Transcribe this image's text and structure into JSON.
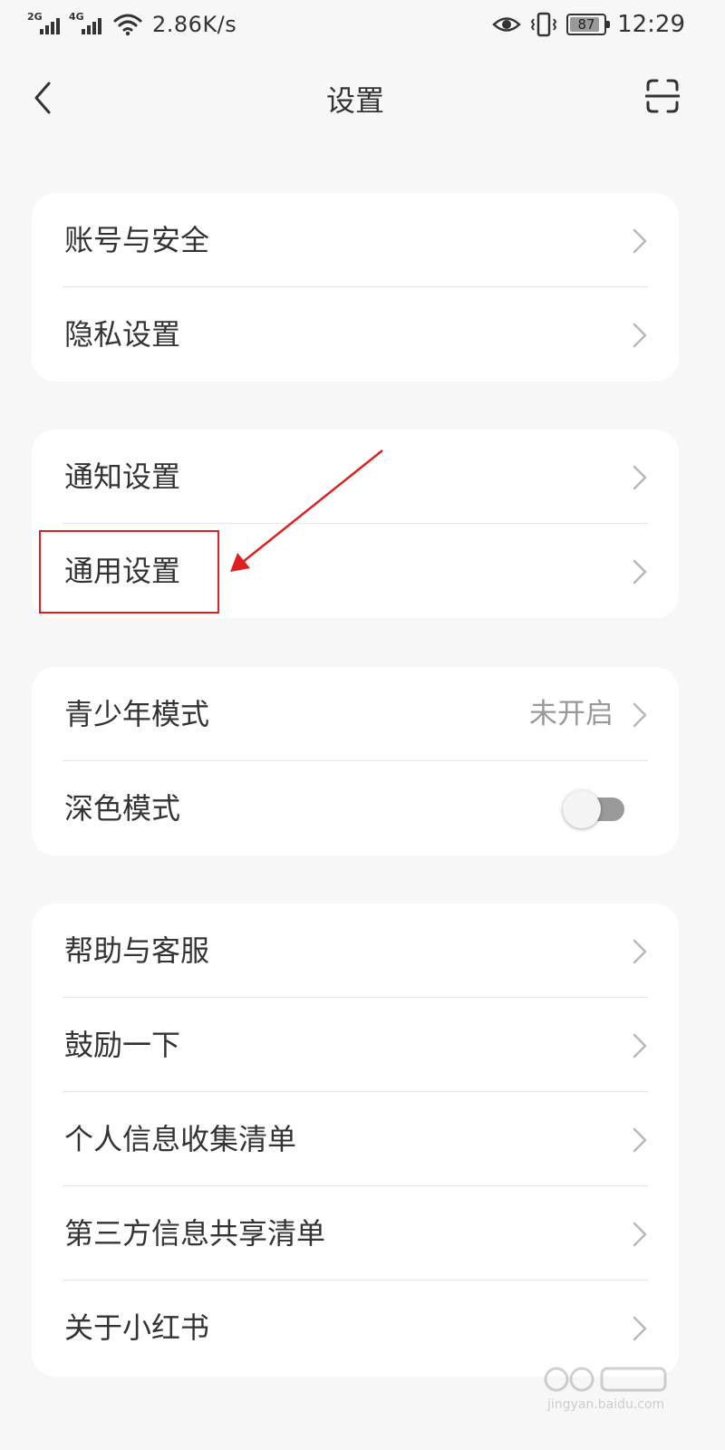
{
  "status_bar": {
    "net1": "2G",
    "net2": "4G",
    "speed": "2.86K/s",
    "battery": "87",
    "time": "12:29"
  },
  "header": {
    "title": "设置"
  },
  "groups": [
    {
      "items": [
        {
          "label": "账号与安全"
        },
        {
          "label": "隐私设置"
        }
      ]
    },
    {
      "items": [
        {
          "label": "通知设置"
        },
        {
          "label": "通用设置"
        }
      ]
    },
    {
      "items": [
        {
          "label": "青少年模式",
          "value": "未开启"
        },
        {
          "label": "深色模式",
          "toggle": false
        }
      ]
    },
    {
      "items": [
        {
          "label": "帮助与客服"
        },
        {
          "label": "鼓励一下"
        },
        {
          "label": "个人信息收集清单"
        },
        {
          "label": "第三方信息共享清单"
        },
        {
          "label": "关于小红书"
        }
      ]
    }
  ],
  "watermark": {
    "text": "jingyan.baidu.com"
  },
  "colors": {
    "background": "#f7f7f7",
    "card": "#ffffff",
    "annotation": "#e02020"
  }
}
